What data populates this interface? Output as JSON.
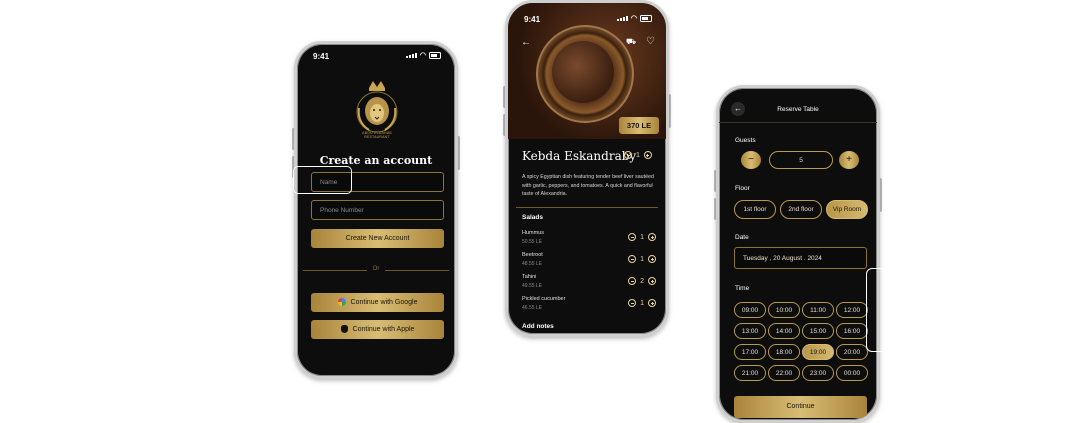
{
  "status_time": "9:41",
  "signup": {
    "logo_text": "ABOU ELDAHAB RESTAURANT",
    "title": "Create an account",
    "name_placeholder": "Name",
    "phone_placeholder": "Phone Number",
    "create_button": "Create New Account",
    "divider": "Or",
    "google_button": "Continue with Google",
    "apple_button": "Continue with Apple"
  },
  "dish": {
    "price": "370 LE",
    "title": "Kebda Eskandraby",
    "quantity": "1",
    "description": "A spicy Egyptian dish featuring tender beef liver sautéed with garlic, peppers, and tomatoes. A quick and flavorful taste of Alexandria.",
    "salads_heading": "Salads",
    "salads": [
      {
        "name": "Hummus",
        "price": "50.55 LE",
        "qty": "1"
      },
      {
        "name": "Beetroot",
        "price": "48.55 LE",
        "qty": "1"
      },
      {
        "name": "Tahini",
        "price": "49.55 LE",
        "qty": "2"
      },
      {
        "name": "Pickled cucumber",
        "price": "46.55 LE",
        "qty": "1"
      }
    ],
    "notes_heading": "Add notes"
  },
  "reserve": {
    "title": "Reserve Table",
    "guests_label": "Guests",
    "guests_value": "5",
    "floor_label": "Floor",
    "floors": [
      "1st floor",
      "2nd floor",
      "Vip Room"
    ],
    "selected_floor": "Vip Room",
    "date_label": "Date",
    "date_value": "Tuesday , 20 August . 2024",
    "time_label": "Time",
    "times": [
      "09:00",
      "10:00",
      "11:00",
      "12:00",
      "13:00",
      "14:00",
      "15:00",
      "16:00",
      "17:00",
      "18:00",
      "19:00",
      "20:00",
      "21:00",
      "22:00",
      "23:00",
      "00:00"
    ],
    "selected_time": "19:00",
    "continue_button": "Continue"
  },
  "colors": {
    "gold": "#c9a650",
    "background": "#0d0d0d"
  }
}
